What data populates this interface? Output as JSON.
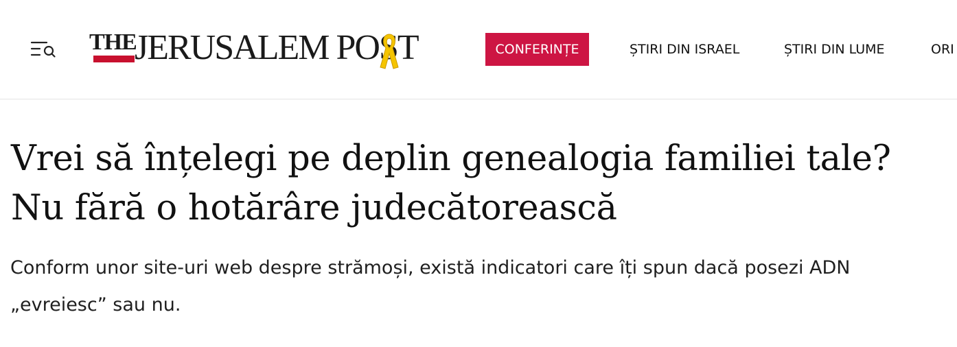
{
  "header": {
    "menu_icon": "menu-search-icon",
    "logo": {
      "prefix": "THE",
      "name": "JERUSALEM POST",
      "ribbon_icon": "yellow-ribbon-icon",
      "accent_color": "#c8102e",
      "ribbon_color": "#f5c400"
    },
    "nav": {
      "cta_label": "CONFERINȚE",
      "cta_color": "#cd1543",
      "items": [
        {
          "label": "ȘTIRI DIN ISRAEL"
        },
        {
          "label": "ȘTIRI DIN LUME"
        },
        {
          "label": "ORI"
        }
      ]
    }
  },
  "article": {
    "title": "Vrei să înțelegi pe deplin genealogia familiei tale? Nu fără o hotărâre judecătorească",
    "subtitle": "Conform unor site-uri web despre strămoși, există indicatori care îți spun dacă posezi ADN „evreiesc” sau nu."
  }
}
